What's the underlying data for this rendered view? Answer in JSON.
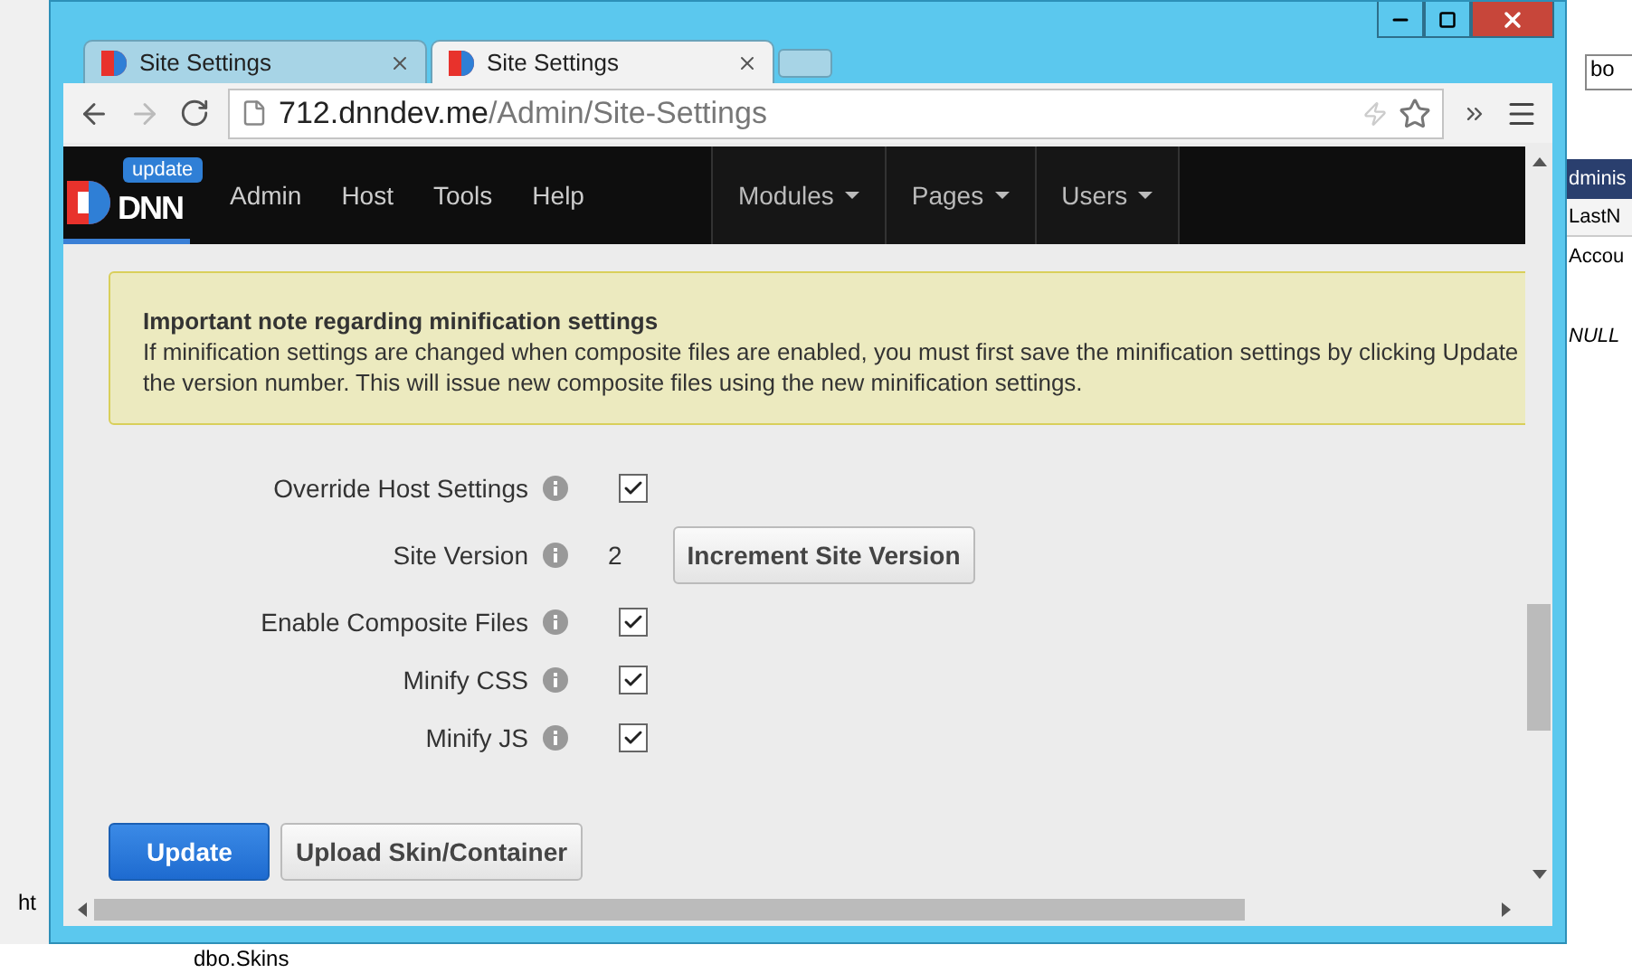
{
  "background": {
    "search_value": "bo",
    "panel_header": "dminis",
    "column_header": "LastN",
    "cells": [
      "Accou",
      "NULL"
    ],
    "status_text": "ht",
    "tree_item": "dbo.Skins"
  },
  "tabs": [
    {
      "title": "Site Settings",
      "selected": false
    },
    {
      "title": "Site Settings",
      "selected": true
    }
  ],
  "address": {
    "host": "712.dnndev.me",
    "path": "/Admin/Site-Settings"
  },
  "nav": {
    "badge": "update",
    "logo": "DNN",
    "links": [
      "Admin",
      "Host",
      "Tools",
      "Help"
    ],
    "menus": [
      "Modules",
      "Pages",
      "Users"
    ]
  },
  "note": {
    "title": "Important note regarding minification settings",
    "lines": [
      "If minification settings are changed when composite files are enabled, you must first save the minification settings by clicking Update",
      "the version number. This will issue new composite files using the new minification settings."
    ]
  },
  "settings": [
    {
      "kind": "checkbox",
      "label": "Override Host Settings",
      "checked": true
    },
    {
      "kind": "version",
      "label": "Site Version",
      "value": "2",
      "button": "Increment Site Version"
    },
    {
      "kind": "checkbox",
      "label": "Enable Composite Files",
      "checked": true
    },
    {
      "kind": "checkbox",
      "label": "Minify CSS",
      "checked": true
    },
    {
      "kind": "checkbox",
      "label": "Minify JS",
      "checked": true
    }
  ],
  "buttons": [
    {
      "label": "Update",
      "primary": true
    },
    {
      "label": "Upload Skin/Container",
      "primary": false
    }
  ]
}
